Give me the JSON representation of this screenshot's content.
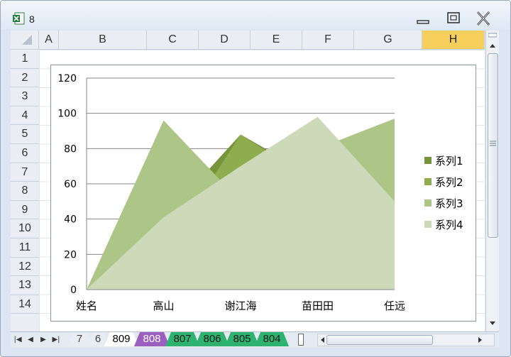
{
  "window": {
    "title": "8"
  },
  "columns": [
    "A",
    "B",
    "C",
    "D",
    "E",
    "F",
    "G",
    "H"
  ],
  "selected_column": "H",
  "rows": [
    "1",
    "2",
    "3",
    "4",
    "5",
    "6",
    "7",
    "8",
    "9",
    "10",
    "11",
    "12",
    "13",
    "14"
  ],
  "sheet_tabs": [
    {
      "label": "7",
      "color": "#e8edf3",
      "text_color": "#444"
    },
    {
      "label": "6",
      "color": "#e8edf3",
      "text_color": "#444"
    },
    {
      "label": "809",
      "color": "#ffffff",
      "text_color": "#000"
    },
    {
      "label": "808",
      "color": "#9b5fc0",
      "text_color": "#ffffff"
    },
    {
      "label": "807",
      "color": "#2db370",
      "text_color": "#1a1a1a"
    },
    {
      "label": "806",
      "color": "#2db370",
      "text_color": "#1a1a1a"
    },
    {
      "label": "805",
      "color": "#2db370",
      "text_color": "#1a1a1a"
    },
    {
      "label": "804",
      "color": "#2db370",
      "text_color": "#1a1a1a"
    }
  ],
  "chart_data": {
    "type": "area",
    "categories": [
      "姓名",
      "高山",
      "谢江海",
      "苗田田",
      "任远"
    ],
    "ylim": [
      0,
      120
    ],
    "yticks": [
      0,
      20,
      40,
      60,
      80,
      100,
      120
    ],
    "grid": true,
    "legend_position": "right",
    "series": [
      {
        "name": "系列1",
        "values": [
          0,
          40,
          88,
          63,
          63
        ],
        "color": "#77933c"
      },
      {
        "name": "系列2",
        "values": [
          0,
          20,
          88,
          60,
          80
        ],
        "color": "#8fad4f"
      },
      {
        "name": "系列3",
        "values": [
          0,
          96,
          50,
          80,
          97
        ],
        "color": "#adc687"
      },
      {
        "name": "系列4",
        "values": [
          0,
          41,
          70,
          98,
          50
        ],
        "color": "#cddab9"
      }
    ]
  }
}
